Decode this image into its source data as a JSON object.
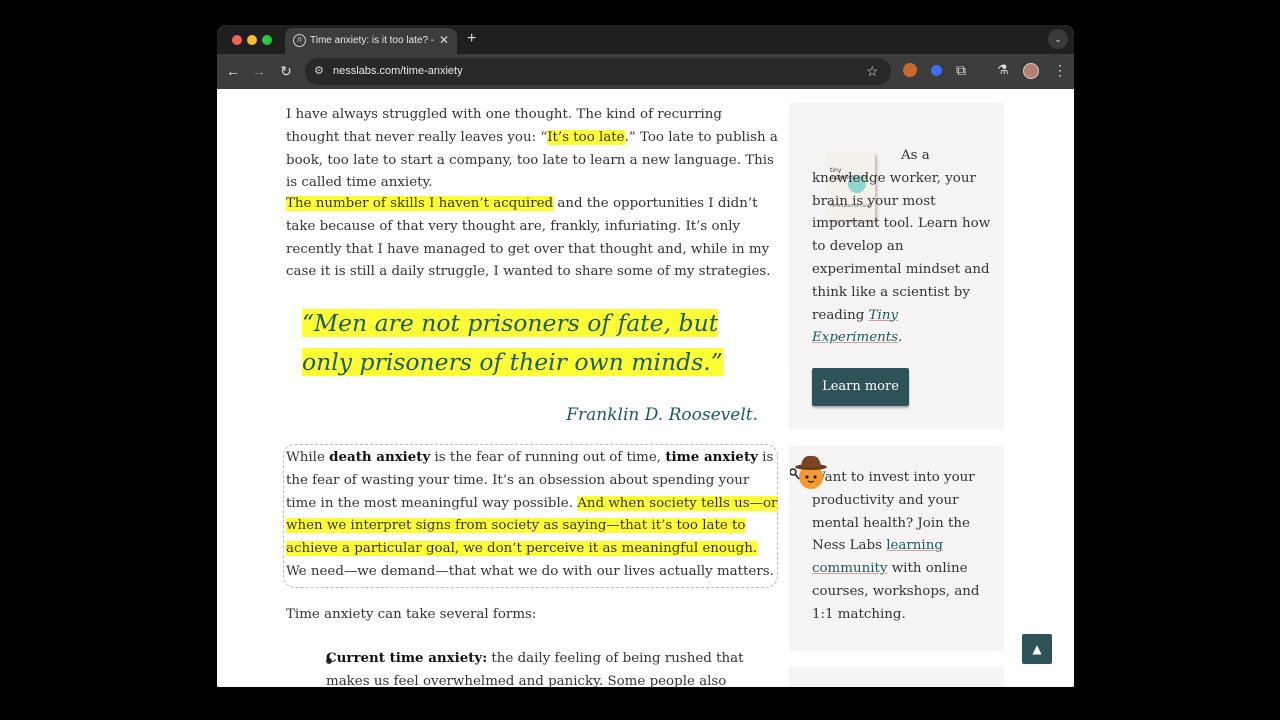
{
  "browser": {
    "tab_title": "Time anxiety: is it too late? - Ness Labs",
    "tab_close": "✕",
    "new_tab": "+",
    "url": "nesslabs.com/time-anxiety"
  },
  "article": {
    "p1_a": "I have always struggled with one thought. The kind of recurring thought that never really leaves you: “",
    "p1_hl": "It’s too late",
    "p1_b": ".” Too late to publish a book, too late to start a company, too late to learn a new language. This is called time anxiety.",
    "p2_hl": "The number of skills I haven’t acquired",
    "p2_b": " and the opportunities I didn’t take because of that very thought are, frankly, infuriating. It’s only recently that I have managed to get over that thought and, while in my case it is still a daily struggle, I wanted to share some of my strategies.",
    "quote": "“Men are not prisoners of fate, but only prisoners of their own minds.”",
    "quote_author": "Franklin D. Roosevelt.",
    "p3_a": "While ",
    "p3_b1": "death anxiety",
    "p3_c": " is the fear of running out of time, ",
    "p3_b2": "time anxiety",
    "p3_d": " is the fear of wasting your time. It’s an obsession about spending your time in the most meaningful way possible. ",
    "p3_hl": "And when society tells us—or when we interpret signs from society as saying—that it’s too late to achieve a particular goal, we don’t perceive it as meaningful enough.",
    "p3_e": " We need—we demand—that what we do with our lives actually matters.",
    "p4": "Time anxiety can take several forms:",
    "li1_b": "Current time anxiety:",
    "li1_text": " the daily feeling of being rushed that makes us feel overwhelmed and panicky. Some people also experience anxiety"
  },
  "sidebar": {
    "book_title": "tiny experiments",
    "book_author": "Anne-Laure Le Cunff",
    "card1_text_a": "As a knowledge worker, your brain is your most important tool. Learn how to develop an experimental mindset and think like a scientist by reading ",
    "card1_link": "Tiny Experiments",
    "card1_text_b": ".",
    "learn_more": "Learn more",
    "card2_text_a": "Want to invest into your productivity and your mental health? Join the Ness Labs ",
    "card2_link": "learning community",
    "card2_text_b": " with online courses, workshops, and 1:1 matching."
  },
  "colors": {
    "highlight": "#ffff33",
    "accent": "#1d5a5f",
    "button": "#2e5259"
  }
}
